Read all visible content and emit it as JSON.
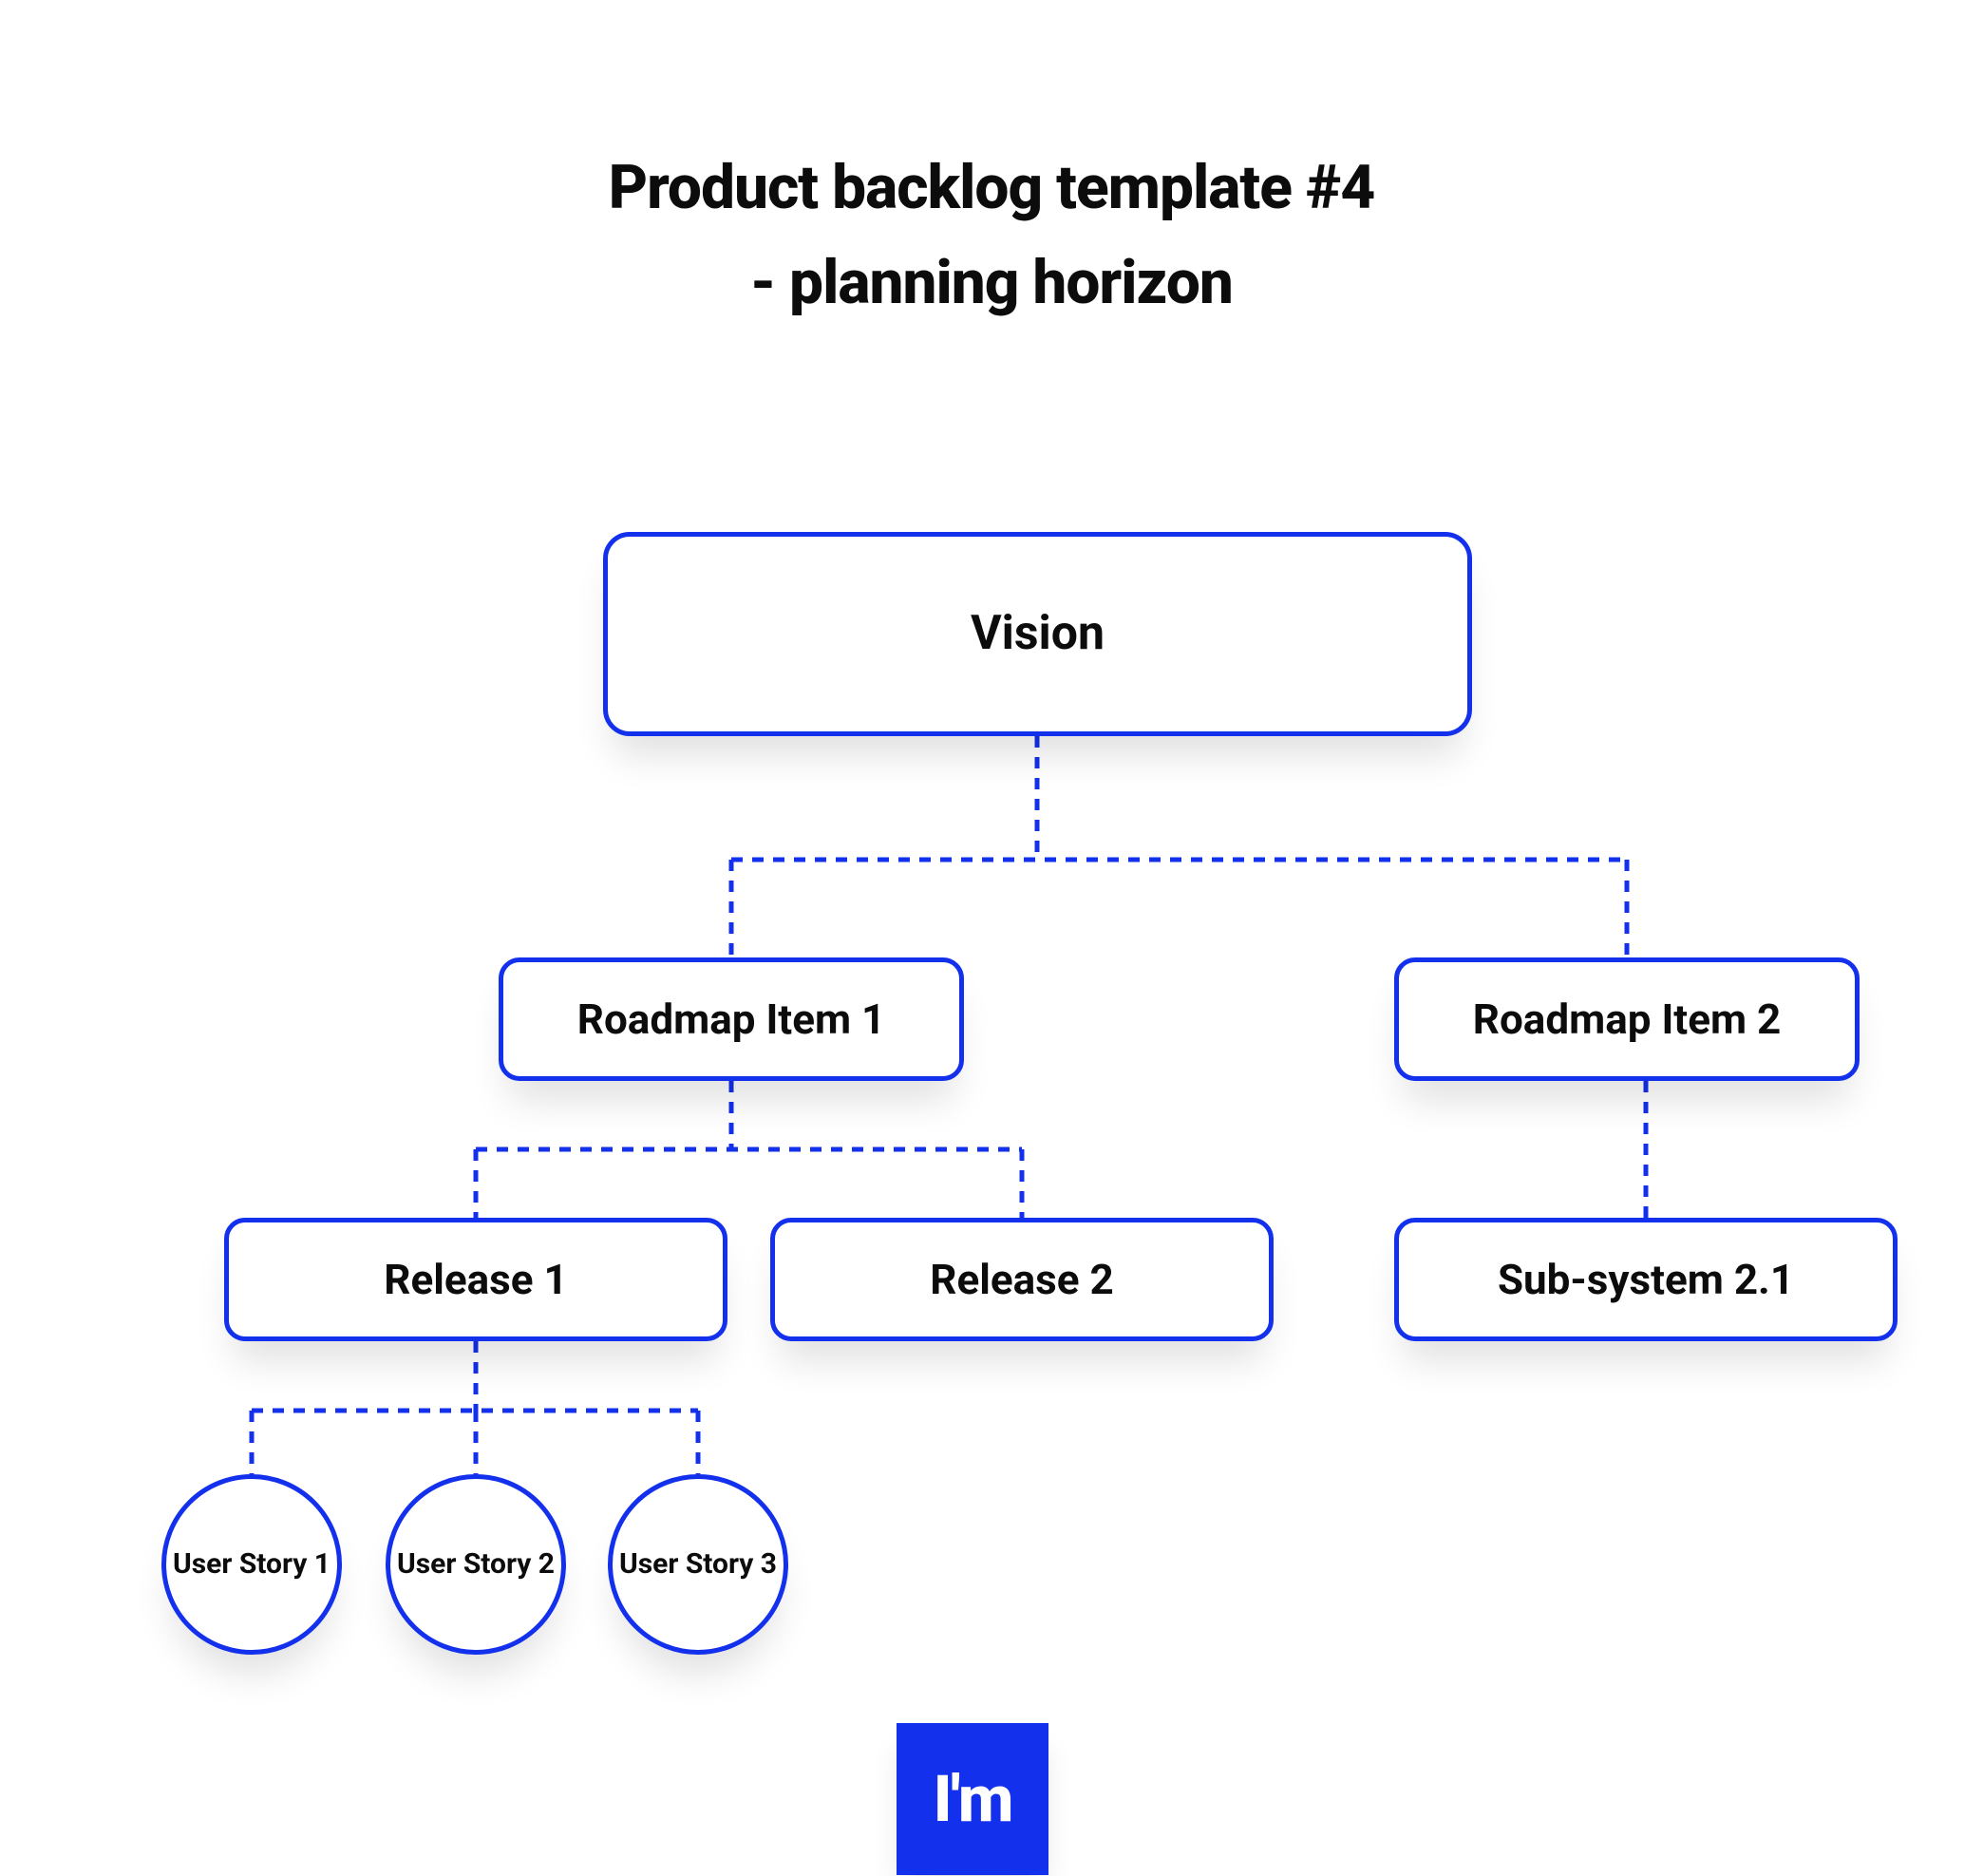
{
  "title": {
    "line1": "Product backlog template #4",
    "line2": "- planning horizon"
  },
  "nodes": {
    "vision": "Vision",
    "roadmap1": "Roadmap Item 1",
    "roadmap2": "Roadmap Item 2",
    "release1": "Release 1",
    "release2": "Release 2",
    "subsystem21": "Sub-system 2.1",
    "story1": "User Story 1",
    "story2": "User Story 2",
    "story3": "User Story 3"
  },
  "logo": {
    "text": "I'm"
  },
  "colors": {
    "accent": "#1330ec",
    "text": "#0c0c0c",
    "bg": "#ffffff"
  }
}
